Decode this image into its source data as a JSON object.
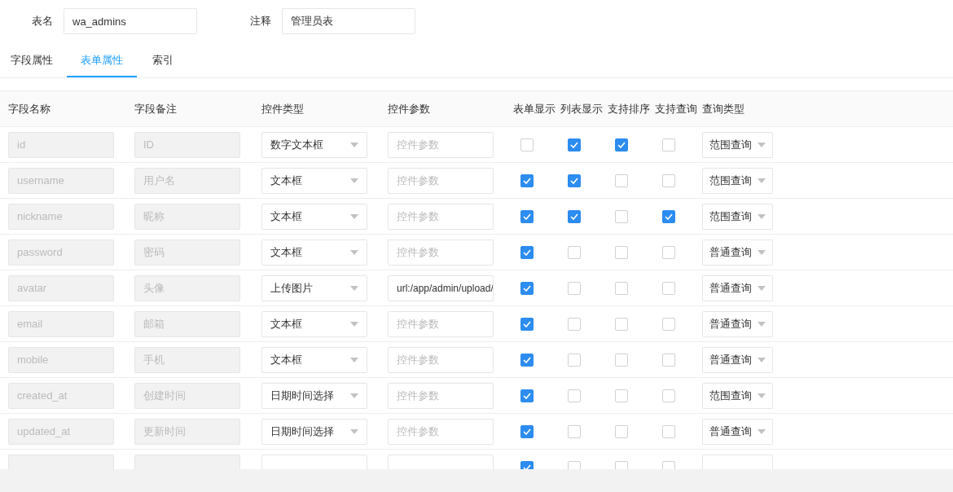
{
  "form": {
    "fields": [
      {
        "label": "表名",
        "value": "wa_admins"
      },
      {
        "label": "注释",
        "value": "管理员表"
      }
    ]
  },
  "tabs": [
    {
      "label": "字段属性",
      "selected": false
    },
    {
      "label": "表单属性",
      "selected": true
    },
    {
      "label": "索引",
      "selected": false
    }
  ],
  "table": {
    "columns": [
      "字段名称",
      "字段备注",
      "控件类型",
      "控件参数",
      "表单显示",
      "列表显示",
      "支持排序",
      "支持查询",
      "查询类型"
    ],
    "rows": [
      {
        "name": "id",
        "remark": "ID",
        "control": "数字文本框",
        "param": {
          "placeholder": "控件参数"
        },
        "form_show": false,
        "list_show": true,
        "sortable": true,
        "searchable": false,
        "query_type": "范围查询"
      },
      {
        "name": "username",
        "remark": "用户名",
        "control": "文本框",
        "param": {
          "placeholder": "控件参数"
        },
        "form_show": true,
        "list_show": true,
        "sortable": false,
        "searchable": false,
        "query_type": "范围查询"
      },
      {
        "name": "nickname",
        "remark": "昵称",
        "control": "文本框",
        "param": {
          "placeholder": "控件参数"
        },
        "form_show": true,
        "list_show": true,
        "sortable": false,
        "searchable": true,
        "query_type": "范围查询"
      },
      {
        "name": "password",
        "remark": "密码",
        "control": "文本框",
        "param": {
          "placeholder": "控件参数"
        },
        "form_show": true,
        "list_show": false,
        "sortable": false,
        "searchable": false,
        "query_type": "普通查询"
      },
      {
        "name": "avatar",
        "remark": "头像",
        "control": "上传图片",
        "param": {
          "value": "url:/app/admin/upload/"
        },
        "form_show": true,
        "list_show": false,
        "sortable": false,
        "searchable": false,
        "query_type": "普通查询"
      },
      {
        "name": "email",
        "remark": "邮箱",
        "control": "文本框",
        "param": {
          "placeholder": "控件参数"
        },
        "form_show": true,
        "list_show": false,
        "sortable": false,
        "searchable": false,
        "query_type": "普通查询"
      },
      {
        "name": "mobile",
        "remark": "手机",
        "control": "文本框",
        "param": {
          "placeholder": "控件参数"
        },
        "form_show": true,
        "list_show": false,
        "sortable": false,
        "searchable": false,
        "query_type": "普通查询"
      },
      {
        "name": "created_at",
        "remark": "创建时间",
        "control": "日期时间选择",
        "param": {
          "placeholder": "控件参数"
        },
        "form_show": true,
        "list_show": false,
        "sortable": false,
        "searchable": false,
        "query_type": "范围查询"
      },
      {
        "name": "updated_at",
        "remark": "更新时间",
        "control": "日期时间选择",
        "param": {
          "placeholder": "控件参数"
        },
        "form_show": true,
        "list_show": false,
        "sortable": false,
        "searchable": false,
        "query_type": "普通查询"
      },
      {
        "form_show": true,
        "list_show": false,
        "sortable": false,
        "searchable": false
      }
    ]
  }
}
